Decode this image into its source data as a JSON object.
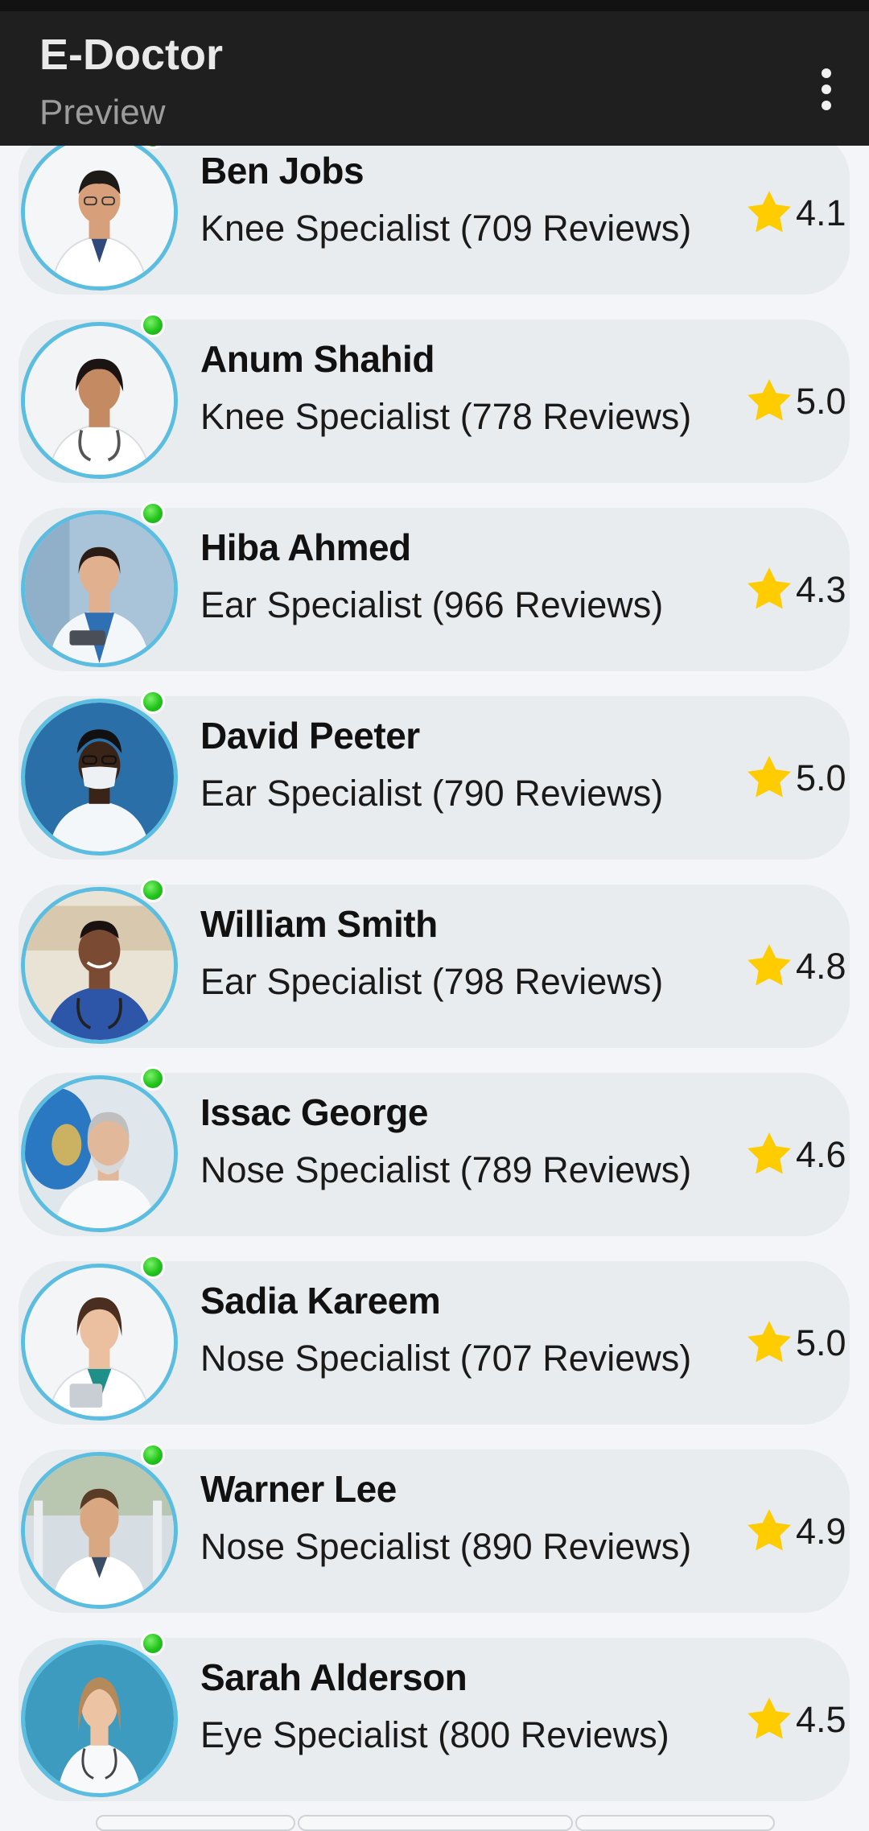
{
  "app_bar": {
    "title": "E-Doctor",
    "subtitle": "Preview",
    "menu_icon": "more-vert-icon"
  },
  "colors": {
    "app_bar": "#1f1f1f",
    "card": "#e8ecee",
    "avatar_ring": "#5bbde0",
    "online": "#22c41c",
    "star": "#ffcc00"
  },
  "doctors": [
    {
      "name": "Ben Jobs",
      "specialty": "Knee Specialist (709 Reviews)",
      "rating": "4.1",
      "online": true
    },
    {
      "name": "Anum Shahid",
      "specialty": "Knee Specialist (778 Reviews)",
      "rating": "5.0",
      "online": true
    },
    {
      "name": "Hiba Ahmed",
      "specialty": "Ear Specialist (966 Reviews)",
      "rating": "4.3",
      "online": true
    },
    {
      "name": "David Peeter",
      "specialty": "Ear Specialist (790 Reviews)",
      "rating": "5.0",
      "online": true
    },
    {
      "name": "William Smith",
      "specialty": "Ear Specialist (798 Reviews)",
      "rating": "4.8",
      "online": true
    },
    {
      "name": "Issac George",
      "specialty": "Nose Specialist (789 Reviews)",
      "rating": "4.6",
      "online": true
    },
    {
      "name": "Sadia Kareem",
      "specialty": "Nose Specialist (707 Reviews)",
      "rating": "5.0",
      "online": true
    },
    {
      "name": "Warner Lee",
      "specialty": "Nose Specialist (890 Reviews)",
      "rating": "4.9",
      "online": true
    },
    {
      "name": "Sarah Alderson",
      "specialty": "Eye Specialist (800 Reviews)",
      "rating": "4.5",
      "online": true
    }
  ]
}
